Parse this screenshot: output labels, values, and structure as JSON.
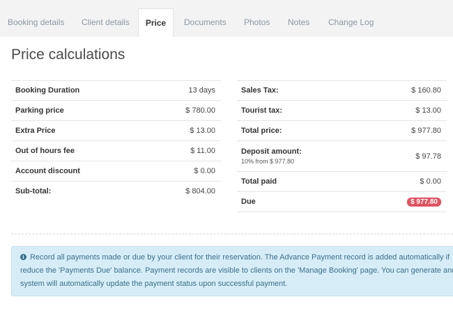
{
  "tabs": [
    {
      "label": "Booking details"
    },
    {
      "label": "Client details"
    },
    {
      "label": "Price",
      "active": true
    },
    {
      "label": "Documents"
    },
    {
      "label": "Photos"
    },
    {
      "label": "Notes"
    },
    {
      "label": "Change Log"
    }
  ],
  "page_title": "Price calculations",
  "left_table": [
    {
      "label": "Booking Duration",
      "value": "13 days"
    },
    {
      "label": "Parking price",
      "value": "$ 780.00"
    },
    {
      "label": "Extra Price",
      "value": "$ 13.00"
    },
    {
      "label": "Out of hours fee",
      "value": "$ 11.00"
    },
    {
      "label": "Account discount",
      "value": "$ 0.00"
    },
    {
      "label": "Sub-total:",
      "value": "$ 804.00"
    }
  ],
  "right_table": [
    {
      "label": "Sales Tax:",
      "value": "$ 160.80"
    },
    {
      "label": "Tourist tax:",
      "value": "$ 13.00"
    },
    {
      "label": "Total price:",
      "value": "$ 977.80"
    },
    {
      "label": "Deposit amount:",
      "note": "10% from $ 977.80",
      "value": "$ 97.78"
    },
    {
      "label": "Total paid",
      "value": "$ 0.00"
    },
    {
      "label": "Due",
      "value": "$ 977.80"
    }
  ],
  "colors": {
    "due_badge": "#e05362",
    "alert_bg": "#d6edf7",
    "alert_text": "#3b6f89"
  },
  "info": {
    "icon": "info-circle-icon",
    "line1": "Record all payments made or due by your client for their reservation. The Advance Payment record is added automatically if",
    "line2": "reduce the 'Payments Due' balance. Payment records are visible to clients on the 'Manage Booking' page. You can generate and",
    "line3": "system will automatically update the payment status upon successful payment."
  }
}
